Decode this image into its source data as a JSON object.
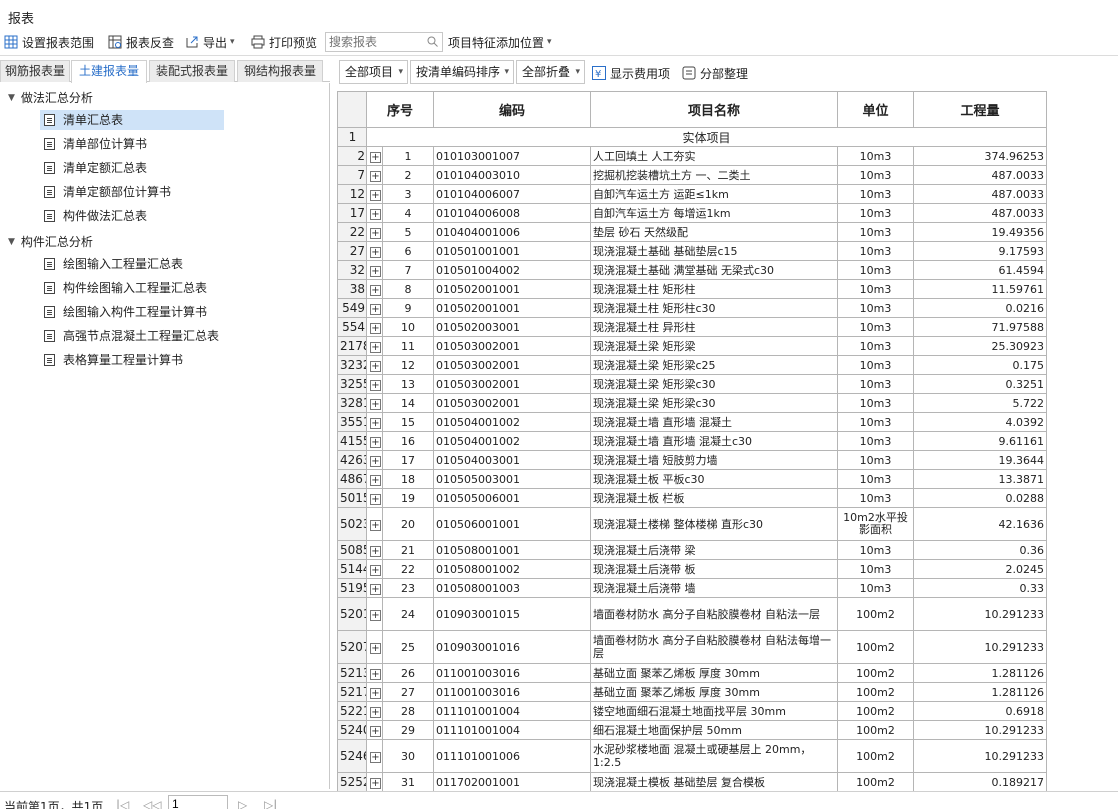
{
  "window": {
    "title": "报表"
  },
  "toolbar": {
    "set_range": "设置报表范围",
    "reverse_check": "报表反查",
    "export": "导出",
    "print_preview": "打印预览",
    "search_placeholder": "搜索报表",
    "feature_position": "项目特征添加位置"
  },
  "tabs": [
    "钢筋报表量",
    "土建报表量",
    "装配式报表量",
    "钢结构报表量"
  ],
  "tree": {
    "group1": "做法汇总分析",
    "group1_items": [
      "清单汇总表",
      "清单部位计算书",
      "清单定额汇总表",
      "清单定额部位计算书",
      "构件做法汇总表"
    ],
    "group2": "构件汇总分析",
    "group2_items": [
      "绘图输入工程量汇总表",
      "构件绘图输入工程量汇总表",
      "绘图输入构件工程量计算书",
      "高强节点混凝土工程量汇总表",
      "表格算量工程量计算书"
    ]
  },
  "right_toolbar": {
    "all_items": "全部项目",
    "sort": "按清单编码排序",
    "fold": "全部折叠",
    "show_fee": "显示费用项",
    "reorganize": "分部整理"
  },
  "table": {
    "headers": {
      "seq": "序号",
      "code": "编码",
      "name": "项目名称",
      "unit": "单位",
      "qty": "工程量"
    },
    "group_row": {
      "rownum": "1",
      "label": "实体项目"
    },
    "rows": [
      {
        "rn": "2",
        "seq": "1",
        "code": "010103001007",
        "name": "人工回填土 人工夯实",
        "unit": "10m3",
        "qty": "374.96253"
      },
      {
        "rn": "7",
        "seq": "2",
        "code": "010104003010",
        "name": "挖掘机挖装槽坑土方 一、二类土",
        "unit": "10m3",
        "qty": "487.0033"
      },
      {
        "rn": "12",
        "seq": "3",
        "code": "010104006007",
        "name": "自卸汽车运土方 运距≤1km",
        "unit": "10m3",
        "qty": "487.0033"
      },
      {
        "rn": "17",
        "seq": "4",
        "code": "010104006008",
        "name": "自卸汽车运土方 每增运1km",
        "unit": "10m3",
        "qty": "487.0033"
      },
      {
        "rn": "22",
        "seq": "5",
        "code": "010404001006",
        "name": "垫层 砂石 天然级配",
        "unit": "10m3",
        "qty": "19.49356"
      },
      {
        "rn": "27",
        "seq": "6",
        "code": "010501001001",
        "name": "现浇混凝土基础 基础垫层c15",
        "unit": "10m3",
        "qty": "9.17593"
      },
      {
        "rn": "32",
        "seq": "7",
        "code": "010501004002",
        "name": "现浇混凝土基础 满堂基础 无梁式c30",
        "unit": "10m3",
        "qty": "61.4594"
      },
      {
        "rn": "38",
        "seq": "8",
        "code": "010502001001",
        "name": "现浇混凝土柱 矩形柱",
        "unit": "10m3",
        "qty": "11.59761"
      },
      {
        "rn": "549",
        "seq": "9",
        "code": "010502001001",
        "name": "现浇混凝土柱 矩形柱c30",
        "unit": "10m3",
        "qty": "0.0216"
      },
      {
        "rn": "554",
        "seq": "10",
        "code": "010502003001",
        "name": "现浇混凝土柱 异形柱",
        "unit": "10m3",
        "qty": "71.97588"
      },
      {
        "rn": "2178",
        "seq": "11",
        "code": "010503002001",
        "name": "现浇混凝土梁 矩形梁",
        "unit": "10m3",
        "qty": "25.30923"
      },
      {
        "rn": "3232",
        "seq": "12",
        "code": "010503002001",
        "name": "现浇混凝土梁 矩形梁c25",
        "unit": "10m3",
        "qty": "0.175"
      },
      {
        "rn": "3255",
        "seq": "13",
        "code": "010503002001",
        "name": "现浇混凝土梁 矩形梁c30",
        "unit": "10m3",
        "qty": "0.3251"
      },
      {
        "rn": "3281",
        "seq": "14",
        "code": "010503002001",
        "name": "现浇混凝土梁 矩形梁c30",
        "unit": "10m3",
        "qty": "5.722"
      },
      {
        "rn": "3551",
        "seq": "15",
        "code": "010504001002",
        "name": "现浇混凝土墙 直形墙 混凝土",
        "unit": "10m3",
        "qty": "4.0392"
      },
      {
        "rn": "4155",
        "seq": "16",
        "code": "010504001002",
        "name": "现浇混凝土墙 直形墙 混凝土c30",
        "unit": "10m3",
        "qty": "9.61161"
      },
      {
        "rn": "4263",
        "seq": "17",
        "code": "010504003001",
        "name": "现浇混凝土墙 短肢剪力墙",
        "unit": "10m3",
        "qty": "19.3644"
      },
      {
        "rn": "4867",
        "seq": "18",
        "code": "010505003001",
        "name": "现浇混凝土板 平板c30",
        "unit": "10m3",
        "qty": "13.3871"
      },
      {
        "rn": "5015",
        "seq": "19",
        "code": "010505006001",
        "name": "现浇混凝土板 栏板",
        "unit": "10m3",
        "qty": "0.0288"
      },
      {
        "rn": "5023",
        "seq": "20",
        "code": "010506001001",
        "name": "现浇混凝土楼梯 整体楼梯 直形c30",
        "unit": "10m2水平投影面积",
        "qty": "42.1636",
        "tall": true
      },
      {
        "rn": "5085",
        "seq": "21",
        "code": "010508001001",
        "name": "现浇混凝土后浇带 梁",
        "unit": "10m3",
        "qty": "0.36"
      },
      {
        "rn": "5144",
        "seq": "22",
        "code": "010508001002",
        "name": "现浇混凝土后浇带 板",
        "unit": "10m3",
        "qty": "2.0245"
      },
      {
        "rn": "5195",
        "seq": "23",
        "code": "010508001003",
        "name": "现浇混凝土后浇带 墙",
        "unit": "10m3",
        "qty": "0.33"
      },
      {
        "rn": "5201",
        "seq": "24",
        "code": "010903001015",
        "name": "墙面卷材防水 高分子自粘胶膜卷材 自粘法一层",
        "unit": "100m2",
        "qty": "10.291233",
        "tall": true
      },
      {
        "rn": "5207",
        "seq": "25",
        "code": "010903001016",
        "name": "墙面卷材防水 高分子自粘胶膜卷材 自粘法每增一层",
        "unit": "100m2",
        "qty": "10.291233",
        "tall": true
      },
      {
        "rn": "5213",
        "seq": "26",
        "code": "011001003016",
        "name": "基础立面 聚苯乙烯板 厚度 30mm",
        "unit": "100m2",
        "qty": "1.281126"
      },
      {
        "rn": "5217",
        "seq": "27",
        "code": "011001003016",
        "name": "基础立面 聚苯乙烯板 厚度 30mm",
        "unit": "100m2",
        "qty": "1.281126"
      },
      {
        "rn": "5221",
        "seq": "28",
        "code": "011101001004",
        "name": "镂空地面细石混凝土地面找平层 30mm",
        "unit": "100m2",
        "qty": "0.6918"
      },
      {
        "rn": "5240",
        "seq": "29",
        "code": "011101001004",
        "name": "细石混凝土地面保护层 50mm",
        "unit": "100m2",
        "qty": "10.291233"
      },
      {
        "rn": "5246",
        "seq": "30",
        "code": "011101001006",
        "name": "水泥砂浆楼地面 混凝土或硬基层上 20mm，1:2.5",
        "unit": "100m2",
        "qty": "10.291233",
        "tall": true
      },
      {
        "rn": "5252",
        "seq": "31",
        "code": "011702001001",
        "name": "现浇混凝土模板 基础垫层 复合模板",
        "unit": "100m2",
        "qty": "0.189217"
      }
    ]
  },
  "status": {
    "page_info": "当前第1页，共1页",
    "page_input": "1"
  }
}
